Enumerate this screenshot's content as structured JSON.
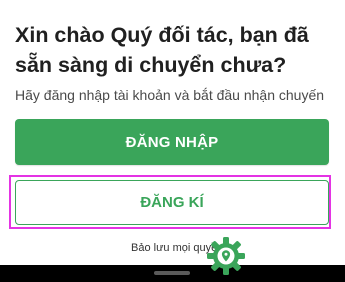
{
  "greeting": {
    "title": "Xin chào Quý đối tác, bạn đã sẵn sàng di chuyển chưa?",
    "subtitle": "Hãy đăng nhập tài khoản và bắt đầu nhận chuyến"
  },
  "actions": {
    "login_label": "ĐĂNG NHẬP",
    "register_label": "ĐĂNG KÍ"
  },
  "footer": {
    "copyright_text": "Bảo lưu mọi quyền"
  },
  "colors": {
    "brand_green": "#3aa55a",
    "highlight_magenta": "#e433e4"
  },
  "icons": {
    "floating_badge": "gear-location-icon"
  }
}
